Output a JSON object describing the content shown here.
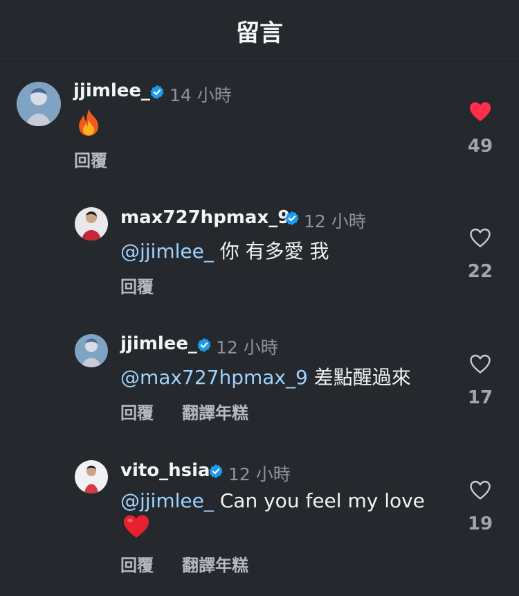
{
  "header": {
    "title": "留言"
  },
  "comments": [
    {
      "username": "jjimlee_",
      "verified": true,
      "time": "14 小時",
      "mention": "",
      "text": "",
      "emoji": "fire-emoji",
      "actions": [
        "回覆"
      ],
      "likes": "49",
      "liked": true
    },
    {
      "username": "max727hpmax_9",
      "verified": true,
      "time": "12 小時",
      "mention": "@jjimlee_",
      "text": " 你  有多愛  我",
      "actions": [
        "回覆"
      ],
      "likes": "22",
      "liked": false
    },
    {
      "username": "jjimlee_",
      "verified": true,
      "time": "12 小時",
      "mention": "@max727hpmax_9",
      "text": " 差點醒過來",
      "actions": [
        "回覆",
        "翻譯年糕"
      ],
      "likes": "17",
      "liked": false
    },
    {
      "username": "vito_hsia",
      "verified": true,
      "time": "12 小時",
      "mention": "@jjimlee_",
      "text": " Can you feel my love",
      "emoji": "red-heart-emoji",
      "actions": [
        "回覆",
        "翻譯年糕"
      ],
      "likes": "19",
      "liked": false
    }
  ],
  "colors": {
    "background": "#25292e",
    "mention": "#9fd3ff",
    "liked": "#ff2e4d",
    "verified": "#1d9bf0"
  }
}
